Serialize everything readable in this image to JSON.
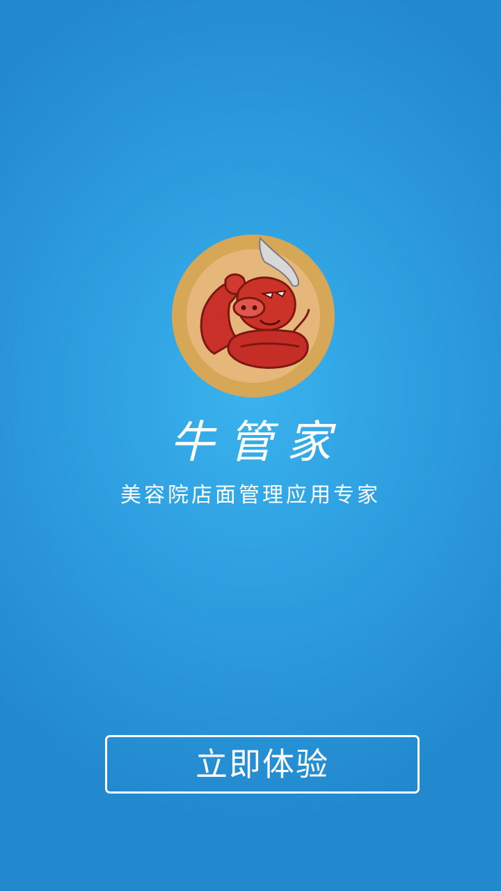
{
  "app": {
    "name": "牛管家",
    "tagline": "美容院店面管理应用专家"
  },
  "cta": {
    "label": "立即体验"
  },
  "logo": {
    "icon": "muscle-bull-icon"
  },
  "colors": {
    "background": "#2e9fe0",
    "logo_ring": "#d4a65a",
    "logo_inner": "#f5c99a",
    "bull_red": "#c8302a",
    "text": "#ffffff"
  }
}
